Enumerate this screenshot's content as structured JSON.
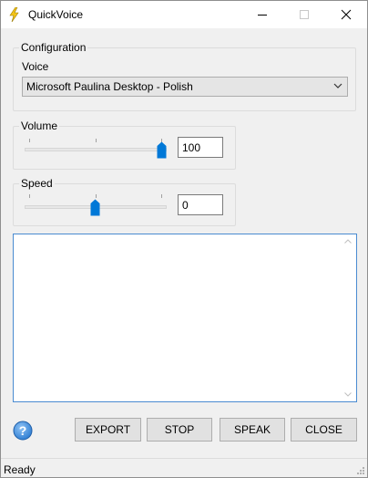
{
  "window": {
    "title": "QuickVoice"
  },
  "configuration": {
    "group_label": "Configuration",
    "voice_label": "Voice",
    "voice_selected": "Microsoft Paulina Desktop - Polish"
  },
  "volume": {
    "label": "Volume",
    "value": "100",
    "slider_fraction": 1.0
  },
  "speed": {
    "label": "Speed",
    "value": "0",
    "slider_fraction": 0.5
  },
  "text_area": {
    "content": ""
  },
  "buttons": {
    "export": "EXPORT",
    "stop": "STOP",
    "speak": "SPEAK",
    "close": "CLOSE"
  },
  "status": {
    "text": "Ready"
  },
  "colors": {
    "accent": "#0078d7",
    "app_icon": "#f5c518",
    "help_icon": "#2b7bd1"
  }
}
